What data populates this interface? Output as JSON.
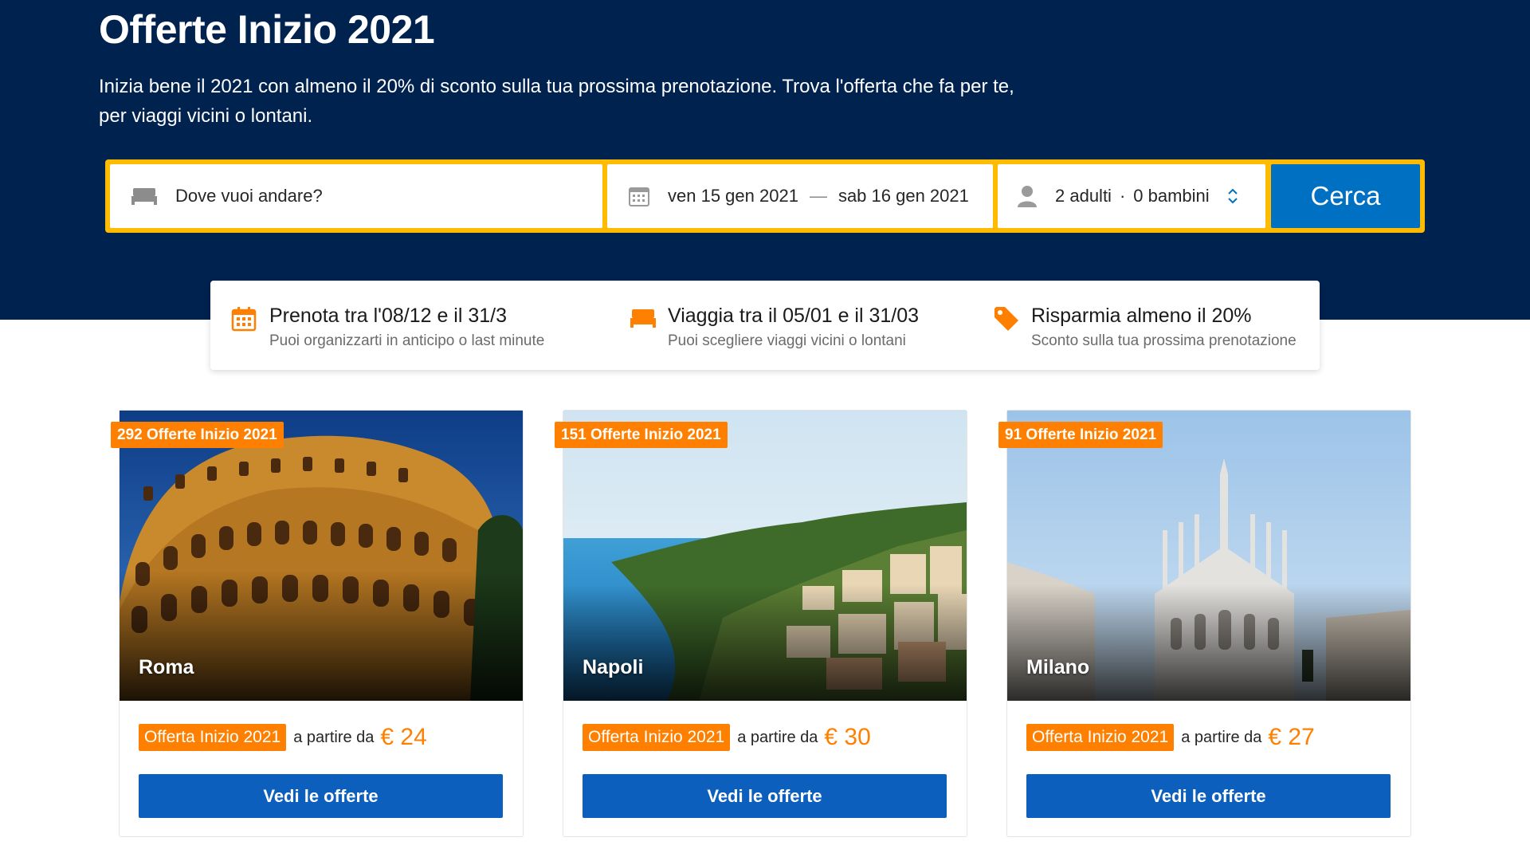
{
  "hero": {
    "title": "Offerte Inizio 2021",
    "subtitle": "Inizia bene il 2021 con almeno il 20% di sconto sulla tua prossima prenotazione. Trova l'offerta che fa per te, per viaggi vicini o lontani."
  },
  "search": {
    "destination_placeholder": "Dove vuoi andare?",
    "checkin": "ven 15 gen 2021",
    "date_separator": "—",
    "checkout": "sab 16 gen 2021",
    "adults": "2 adulti",
    "guest_separator": "·",
    "children": "0 bambini",
    "button": "Cerca",
    "icons": [
      "bed-icon",
      "calendar-icon",
      "person-icon",
      "chevron-updown-icon"
    ]
  },
  "features": [
    {
      "icon": "calendar-icon",
      "title": "Prenota tra l'08/12 e il 31/3",
      "subtitle": "Puoi organizzarti in anticipo o last minute"
    },
    {
      "icon": "bed-icon",
      "title": "Viaggia tra il 05/01 e il 31/03",
      "subtitle": "Puoi scegliere viaggi vicini o lontani"
    },
    {
      "icon": "price-tag-icon",
      "title": "Risparmia almeno il 20%",
      "subtitle": "Sconto sulla tua prossima prenotazione"
    }
  ],
  "cards": [
    {
      "city": "Roma",
      "count_badge": "292 Offerte Inizio 2021",
      "offer_tag": "Offerta Inizio 2021",
      "from_text": "a partire da",
      "price": "€ 24",
      "cta": "Vedi le offerte",
      "image": "colosseum-photo"
    },
    {
      "city": "Napoli",
      "count_badge": "151 Offerte Inizio 2021",
      "offer_tag": "Offerta Inizio 2021",
      "from_text": "a partire da",
      "price": "€ 30",
      "cta": "Vedi le offerte",
      "image": "naples-coast-photo"
    },
    {
      "city": "Milano",
      "count_badge": "91 Offerte Inizio 2021",
      "offer_tag": "Offerta Inizio 2021",
      "from_text": "a partire da",
      "price": "€ 27",
      "cta": "Vedi le offerte",
      "image": "milan-cathedral-photo"
    }
  ],
  "colors": {
    "hero_bg": "#00224f",
    "search_border": "#febb02",
    "primary_button": "#0071c2",
    "accent_orange": "#ff8000"
  }
}
